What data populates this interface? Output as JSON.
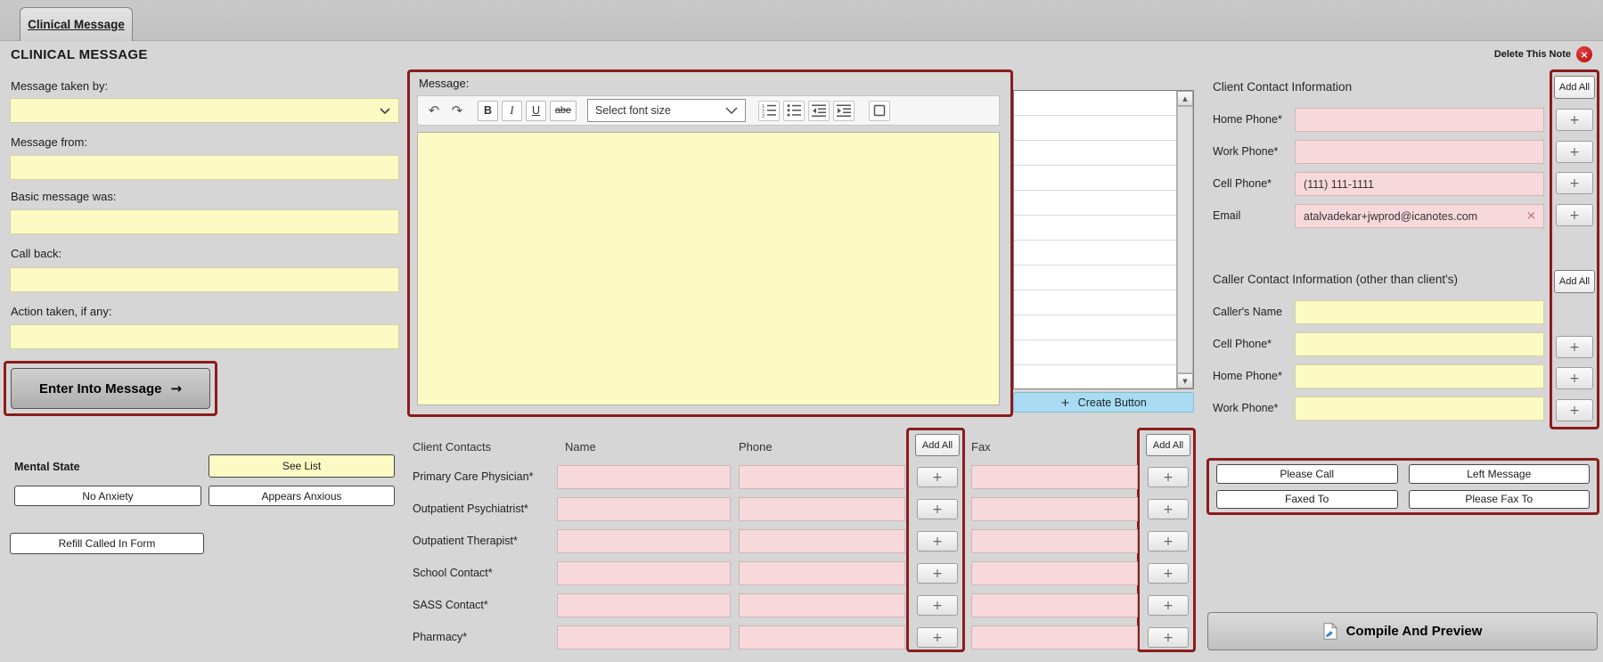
{
  "tab": {
    "label": "Clinical Message"
  },
  "header": {
    "title": "CLINICAL MESSAGE",
    "delete_note": "Delete This Note"
  },
  "glyphs": {
    "plus": "+",
    "clear": "×",
    "arrow_right": "→",
    "undo": "↶",
    "redo": "↷",
    "up": "▲",
    "down": "▼"
  },
  "left_form": {
    "fields": [
      {
        "label": "Message taken by:"
      },
      {
        "label": "Message from:"
      },
      {
        "label": "Basic message was:"
      },
      {
        "label": "Call back:"
      },
      {
        "label": "Action taken, if any:"
      }
    ],
    "enter_button": "Enter Into Message",
    "mental_state": {
      "title": "Mental State",
      "see_list": "See List",
      "no_anxiety": "No Anxiety",
      "appears_anxious": "Appears Anxious"
    },
    "refill_button": "Refill Called In Form"
  },
  "editor": {
    "label": "Message:",
    "toolbar": {
      "bold": "B",
      "italic": "I",
      "underline": "U",
      "strike": "abe",
      "font_size": "Select font size"
    },
    "body": ""
  },
  "quick_list": {
    "create_button": "Create Button"
  },
  "client_contact": {
    "title": "Client Contact Information",
    "add_all": "Add All",
    "rows": [
      {
        "label": "Home Phone*",
        "value": ""
      },
      {
        "label": "Work Phone*",
        "value": ""
      },
      {
        "label": "Cell Phone*",
        "value": "(111) 111-1111"
      },
      {
        "label": "Email",
        "value": "atalvadekar+jwprod@icanotes.com"
      }
    ]
  },
  "caller_contact": {
    "title": "Caller Contact Information (other than client's)",
    "add_all": "Add All",
    "rows": [
      {
        "label": "Caller's Name"
      },
      {
        "label": "Cell Phone*"
      },
      {
        "label": "Home Phone*"
      },
      {
        "label": "Work Phone*"
      }
    ]
  },
  "contacts_table": {
    "title": "Client Contacts",
    "name_header": "Name",
    "phone_header": "Phone",
    "fax_header": "Fax",
    "add_all": "Add All",
    "rows": [
      {
        "label": "Primary Care Physician*"
      },
      {
        "label": "Outpatient Psychiatrist*"
      },
      {
        "label": "Outpatient Therapist*"
      },
      {
        "label": "School Contact*"
      },
      {
        "label": "SASS Contact*"
      },
      {
        "label": "Pharmacy*"
      }
    ]
  },
  "actions": {
    "please_call": "Please Call",
    "left_message": "Left Message",
    "faxed_to": "Faxed To",
    "please_fax_to": "Please Fax To",
    "compile": "Compile And Preview"
  },
  "colors": {
    "accent_red": "#8b1c1c",
    "yellow_field": "#fbfbc3",
    "pink_field": "#f8d9db",
    "create_blue": "#a9dcf2"
  }
}
